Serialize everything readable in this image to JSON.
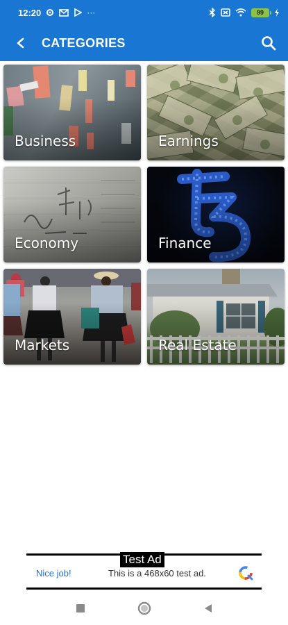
{
  "status_bar": {
    "time": "12:20",
    "more": "···",
    "battery": "99"
  },
  "app_bar": {
    "title": "CATEGORIES"
  },
  "categories": [
    {
      "label": "Business"
    },
    {
      "label": "Earnings"
    },
    {
      "label": "Economy"
    },
    {
      "label": "Finance"
    },
    {
      "label": "Markets"
    },
    {
      "label": "Real Estate"
    }
  ],
  "ad": {
    "tag": "Test Ad",
    "nice": "Nice job!",
    "text": "This is a 468x60 test ad."
  },
  "colors": {
    "app_bar": "#1976d2",
    "battery": "#8bc34a",
    "ad_link": "#1a73e8"
  }
}
